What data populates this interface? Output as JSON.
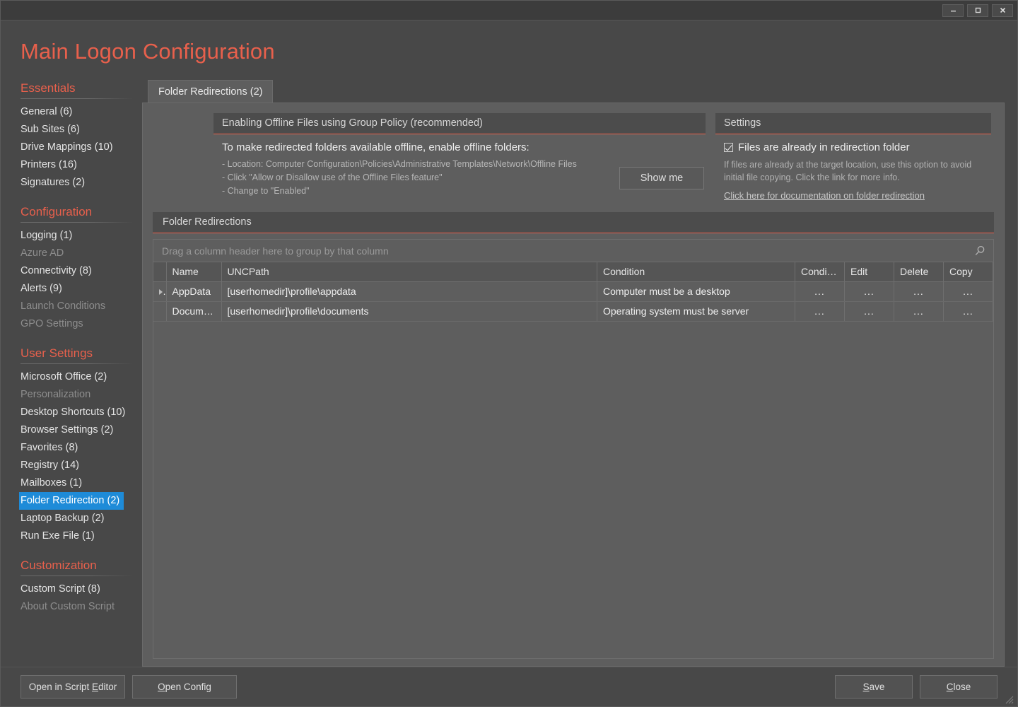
{
  "window": {
    "title": "Main Logon Configuration",
    "controls": {
      "minimize": "minimize-icon",
      "maximize": "maximize-icon",
      "close": "close-icon"
    }
  },
  "sidebar": {
    "groups": [
      {
        "title": "Essentials",
        "items": [
          {
            "label": "General (6)",
            "state": "normal"
          },
          {
            "label": "Sub Sites (6)",
            "state": "normal"
          },
          {
            "label": "Drive Mappings (10)",
            "state": "normal"
          },
          {
            "label": "Printers (16)",
            "state": "normal"
          },
          {
            "label": "Signatures (2)",
            "state": "normal"
          }
        ]
      },
      {
        "title": "Configuration",
        "items": [
          {
            "label": "Logging (1)",
            "state": "normal"
          },
          {
            "label": "Azure AD",
            "state": "disabled"
          },
          {
            "label": "Connectivity (8)",
            "state": "normal"
          },
          {
            "label": "Alerts (9)",
            "state": "normal"
          },
          {
            "label": "Launch Conditions",
            "state": "disabled"
          },
          {
            "label": "GPO Settings",
            "state": "disabled"
          }
        ]
      },
      {
        "title": "User Settings",
        "items": [
          {
            "label": "Microsoft Office (2)",
            "state": "normal"
          },
          {
            "label": "Personalization",
            "state": "disabled"
          },
          {
            "label": "Desktop Shortcuts (10)",
            "state": "normal"
          },
          {
            "label": "Browser Settings (2)",
            "state": "normal"
          },
          {
            "label": "Favorites (8)",
            "state": "normal"
          },
          {
            "label": "Registry (14)",
            "state": "normal"
          },
          {
            "label": "Mailboxes (1)",
            "state": "normal"
          },
          {
            "label": "Folder Redirection (2)",
            "state": "selected"
          },
          {
            "label": "Laptop Backup (2)",
            "state": "normal"
          },
          {
            "label": "Run Exe File (1)",
            "state": "normal"
          }
        ]
      },
      {
        "title": "Customization",
        "items": [
          {
            "label": "Custom Script (8)",
            "state": "normal"
          },
          {
            "label": "About Custom Script",
            "state": "disabled"
          }
        ]
      }
    ]
  },
  "tabs": [
    {
      "label": "Folder Redirections (2)",
      "active": true
    }
  ],
  "offline_box": {
    "header": "Enabling Offline Files using Group Policy (recommended)",
    "lead": "To make redirected folders available offline, enable offline folders:",
    "bullets": [
      "- Location: Computer Configuration\\Policies\\Administrative Templates\\Network\\Offline Files",
      "- Click \"Allow or Disallow use of the Offline Files feature\"",
      "- Change to \"Enabled\""
    ],
    "show_me_button": "Show me"
  },
  "settings_box": {
    "header": "Settings",
    "checkbox_label": "Files are already in redirection folder",
    "checkbox_checked": true,
    "note": "If files are already at the target location, use this option to avoid initial file copying. Click the link for more info.",
    "link": "Click here for documentation on folder redirection"
  },
  "grid_section": {
    "header": "Folder Redirections",
    "group_hint": "Drag a column header here to group by that column",
    "search_icon": "search-icon",
    "columns": [
      "",
      "Name",
      "UNCPath",
      "Condition",
      "Condition",
      "Edit",
      "Delete",
      "Copy"
    ],
    "rows": [
      {
        "indicator": true,
        "name": "AppData",
        "uncpath": "[userhomedir]\\profile\\appdata",
        "condition": "Computer must be a desktop",
        "condition_action": "...",
        "edit_action": "...",
        "delete_action": "...",
        "copy_action": "..."
      },
      {
        "indicator": false,
        "name": "Docume...",
        "uncpath": "[userhomedir]\\profile\\documents",
        "condition": "Operating system must be server",
        "condition_action": "...",
        "edit_action": "...",
        "delete_action": "...",
        "copy_action": "..."
      }
    ]
  },
  "footer": {
    "open_script_editor": "Open in Script Editor",
    "open_script_editor_accel": "E",
    "open_config": "Open Config",
    "open_config_accel": "O",
    "save": "Save",
    "save_accel": "S",
    "close": "Close",
    "close_accel": "C"
  },
  "colors": {
    "accent": "#e8604c",
    "selection": "#1e8bd8",
    "window_bg": "#484848",
    "panel_bg": "#5e5e5e",
    "header_bg": "#4c4c4c"
  }
}
